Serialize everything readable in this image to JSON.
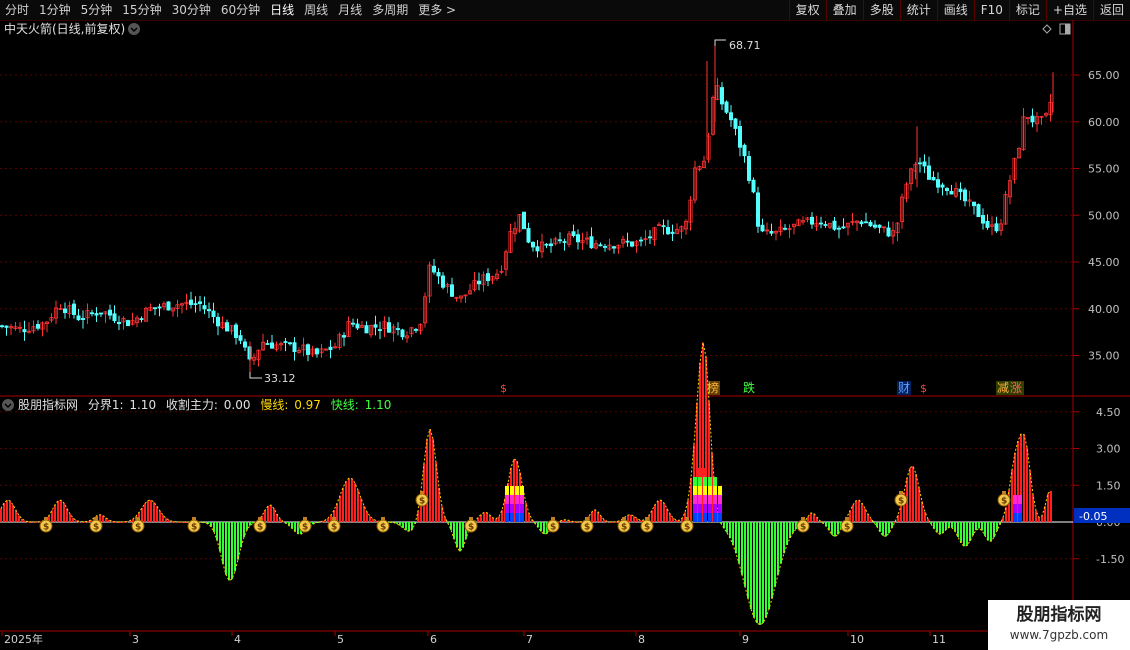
{
  "toolbar": {
    "timeframes": [
      "分时",
      "1分钟",
      "5分钟",
      "15分钟",
      "30分钟",
      "60分钟",
      "日线",
      "周线",
      "月线",
      "多周期",
      "更多"
    ],
    "active": "日线",
    "more_arrow": ">",
    "right_buttons": [
      "复权",
      "叠加",
      "多股",
      "统计",
      "画线",
      "F10",
      "标记",
      "+自选",
      "返回"
    ]
  },
  "price_panel": {
    "title": "中天火箭(日线,前复权)",
    "y_ticks": [
      "65.00",
      "60.00",
      "55.00",
      "50.00",
      "45.00",
      "40.00",
      "35.00"
    ],
    "high_label": "68.71",
    "low_label": "33.12",
    "markers": [
      {
        "text": "$",
        "color": "#ff4040"
      },
      {
        "text": "榜",
        "color": "#ffb040",
        "bg": "#604000"
      },
      {
        "text": "跌",
        "color": "#40ff40"
      },
      {
        "text": "财",
        "color": "#60a0ff",
        "bg": "#002060"
      },
      {
        "text": "$",
        "color": "#ff4040"
      },
      {
        "text": "减",
        "color": "#ffb040"
      },
      {
        "text": "涨",
        "color": "#ff6060"
      }
    ]
  },
  "indicator_panel": {
    "name": "股朋指标网",
    "fields": [
      {
        "label": "分界1:",
        "value": "1.10",
        "color": "#e0e0e0"
      },
      {
        "label": "收割主力:",
        "value": "0.00",
        "color": "#e0e0e0"
      },
      {
        "label": "慢线:",
        "value": "0.97",
        "color": "#ffd700"
      },
      {
        "label": "快线:",
        "value": "1.10",
        "color": "#40ff40"
      }
    ],
    "y_ticks": [
      "4.50",
      "3.00",
      "1.50",
      "0.00",
      "-1.50"
    ],
    "current_value": "-0.05"
  },
  "x_axis": {
    "labels": [
      "2025年",
      "3",
      "4",
      "5",
      "6",
      "7",
      "8",
      "9",
      "10",
      "11"
    ]
  },
  "watermark": {
    "line1": "股朋指标网",
    "line2": "www.7gpzb.com"
  },
  "colors": {
    "up": "#ff3333",
    "down": "#54ffff",
    "grid": "#5a0000",
    "axis": "#aa0000"
  },
  "icons": [
    "chevron-down-icon",
    "diamond-icon",
    "panel-toggle-icon",
    "money-bag-icon"
  ]
}
